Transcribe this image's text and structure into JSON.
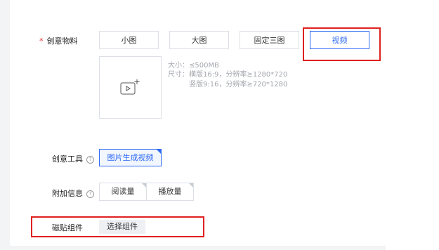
{
  "creative_material": {
    "label": "创意物料",
    "required_mark": "*",
    "tabs": [
      {
        "label": "小图",
        "active": false
      },
      {
        "label": "大图",
        "active": false
      },
      {
        "label": "固定三图",
        "active": false
      },
      {
        "label": "视频",
        "active": true
      }
    ],
    "upload_icon": "video-add-icon",
    "hints": {
      "size": "大小：≤500MB",
      "dimension_landscape": "尺寸：横版16:9，分辨率≥1280*720",
      "dimension_portrait": "竖版9:16，分辨率≥720*1280"
    }
  },
  "creative_tool": {
    "label": "创意工具",
    "button_label": "图片生成视频"
  },
  "extra_info": {
    "label": "附加信息",
    "tags": [
      "阅读量",
      "播放量"
    ]
  },
  "sticker_component": {
    "label": "磁贴组件",
    "button_label": "选择组件"
  },
  "colors": {
    "accent": "#2f6bf5",
    "highlight_box": "#e02020",
    "required": "#e02020"
  }
}
